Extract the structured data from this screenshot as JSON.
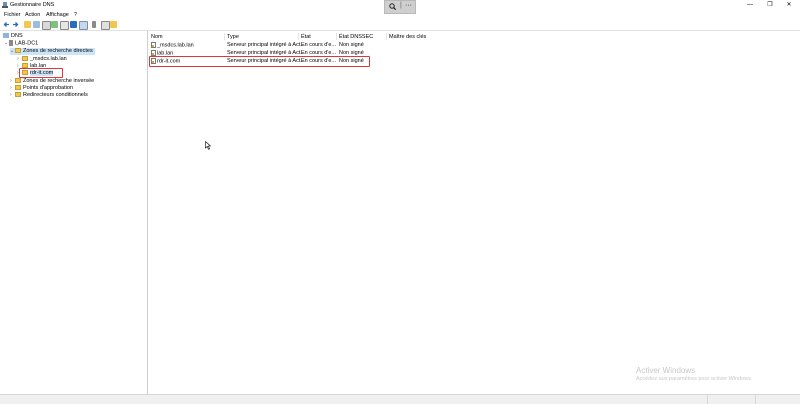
{
  "window": {
    "title": "Gestionnaire DNS",
    "minimize_glyph": "—",
    "maximize_glyph": "❐",
    "close_glyph": "✕"
  },
  "remote_bar": {
    "zoom_icon": "zoom-icon",
    "separator": "|",
    "more": "···"
  },
  "menu": [
    "Fichier",
    "Action",
    "Affichage",
    "?"
  ],
  "toolbar": {
    "icons": [
      "back-arrow-icon",
      "forward-arrow-icon",
      "folder-up-icon",
      "console-tree-icon",
      "properties-icon",
      "refresh-icon",
      "export-list-icon",
      "help-icon",
      "split-view-icon",
      "server-icon",
      "list-icon",
      "folder-icon"
    ]
  },
  "tree": {
    "root": "DNS",
    "server": "LAB-DC1",
    "forward_zones": "Zones de recherche directes",
    "zone_msdcs": "_msdcs.lab.lan",
    "zone_lab": "lab.lan",
    "zone_rdr": "rdr-it.com",
    "reverse_zones": "Zones de recherche inversée",
    "trust_points": "Points d'approbation",
    "conditional_forwarders": "Redirecteurs conditionnels"
  },
  "list": {
    "columns": [
      "Nom",
      "Type",
      "État",
      "État DNSSEC",
      "Maître des clés"
    ],
    "rows": [
      [
        "_msdcs.lab.lan",
        "Serveur principal intégré à Act...",
        "En cours d'e...",
        "Non signé",
        ""
      ],
      [
        "lab.lan",
        "Serveur principal intégré à Act...",
        "En cours d'e...",
        "Non signé",
        ""
      ],
      [
        "rdr-it.com",
        "Serveur principal intégré à Act...",
        "En cours d'e...",
        "Non signé",
        ""
      ]
    ],
    "highlighted_row": 2
  },
  "watermark": {
    "title": "Activer Windows",
    "subtitle": "Accédez aux paramètres pour activer Windows."
  },
  "colors": {
    "highlight": "#cce4f7",
    "annotation_red": "#e0363b",
    "folder": "#f2c74f"
  }
}
